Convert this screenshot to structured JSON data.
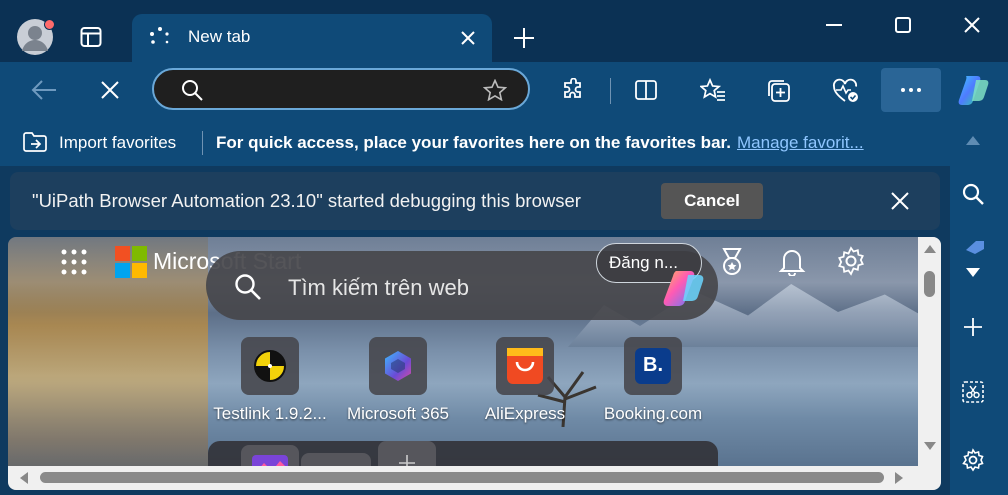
{
  "window": {
    "tab_title": "New tab"
  },
  "address_bar": {
    "placeholder": ""
  },
  "favorites_bar": {
    "import_label": "Import favorites",
    "message": "For quick access, place your favorites here on the favorites bar.",
    "manage_link": "Manage favorit..."
  },
  "infobar": {
    "message": "\"UiPath Browser Automation 23.10\" started debugging this browser",
    "cancel_label": "Cancel"
  },
  "start_page": {
    "brand": "Microsoft Start",
    "search_placeholder": "Tìm kiếm trên web",
    "sign_in_label": "Đăng n...",
    "tiles": [
      {
        "label": "Testlink 1.9.2...",
        "color": "#f2d20a"
      },
      {
        "label": "Microsoft 365",
        "color": "#3b6fd8"
      },
      {
        "label": "AliExpress",
        "color": "#f04a22"
      },
      {
        "label": "Booking.com",
        "color": "#0a3c8c"
      }
    ]
  },
  "colors": {
    "titlebar": "#0b3154",
    "toolbar": "#0f4a78",
    "accent_link": "#8fc6ff"
  }
}
